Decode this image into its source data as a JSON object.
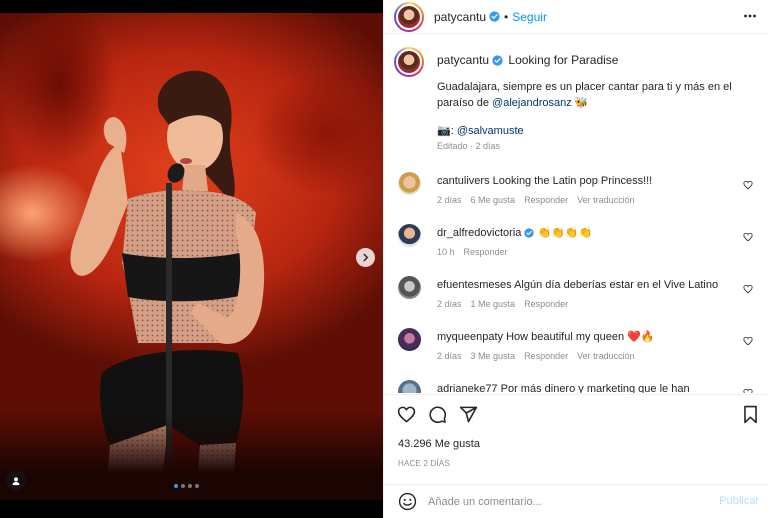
{
  "post": {
    "author": "patycantu",
    "follow_label": "Seguir",
    "separator": "•",
    "location": "Looking for Paradise",
    "caption_text_before": "Guadalajara, siempre es un placer cantar para ti y más en el paraíso de ",
    "caption_mention": "@alejandrosanz",
    "caption_emoji": "🐝",
    "credit_emoji": "📷:",
    "credit_mention": "@salvamuste",
    "edited": "Editado · 2 días"
  },
  "comments": [
    {
      "user": "cantulivers",
      "text": "Looking the Latin pop Princess!!!",
      "time": "2 días",
      "likes": "6 Me gusta",
      "reply": "Responder",
      "translate": "Ver traducción",
      "verified": false
    },
    {
      "user": "dr_alfredovictoria",
      "text": "👏👏👏👏",
      "time": "10 h",
      "likes": "",
      "reply": "Responder",
      "translate": "",
      "verified": true
    },
    {
      "user": "efuentesmeses",
      "text": "Algún día deberías estar en el Vive Latino",
      "time": "2 días",
      "likes": "1 Me gusta",
      "reply": "Responder",
      "translate": "",
      "verified": false
    },
    {
      "user": "myqueenpaty",
      "text": "How beautiful my queen ❤️🔥",
      "time": "2 días",
      "likes": "3 Me gusta",
      "reply": "Responder",
      "translate": "Ver traducción",
      "verified": false
    },
    {
      "user": "adrianeke77",
      "text": "Por más dinero y marketing que le han",
      "time": "",
      "likes": "",
      "reply": "",
      "translate": "",
      "verified": false
    }
  ],
  "stats": {
    "likes": "43.296 Me gusta",
    "date": "HACE 2 DÍAS"
  },
  "composer": {
    "placeholder": "Añade un comentario...",
    "publish_label": "Publicar"
  },
  "carousel": {
    "slide_count": 4,
    "active_index": 0
  },
  "colors": {
    "accent": "#0095f6",
    "verified": "#3897f0",
    "mention": "#00376b",
    "muted": "#8e8e8e"
  },
  "icons": [
    "chevron-right-icon",
    "user-tag-icon",
    "more-icon",
    "verified-icon",
    "heart-icon",
    "comment-icon",
    "share-icon",
    "bookmark-icon",
    "emoji-icon"
  ]
}
